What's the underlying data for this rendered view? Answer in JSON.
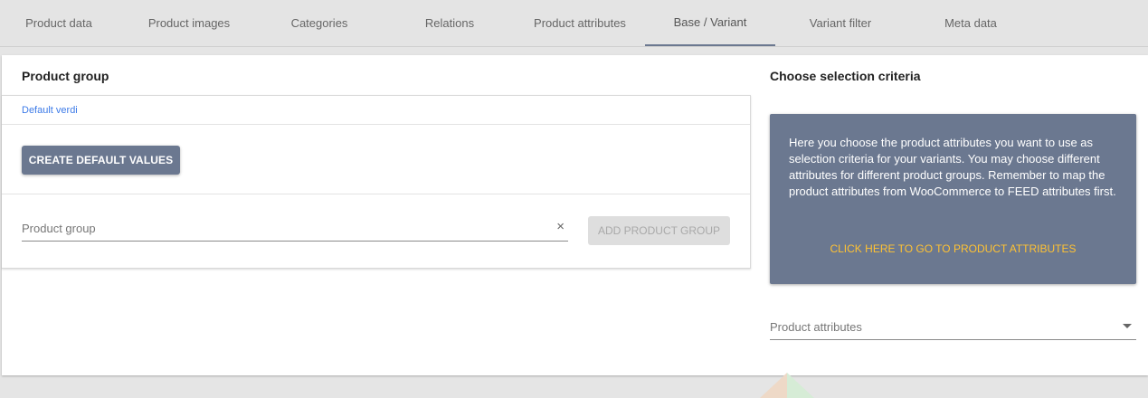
{
  "tabs": [
    {
      "label": "Product data"
    },
    {
      "label": "Product images"
    },
    {
      "label": "Categories"
    },
    {
      "label": "Relations"
    },
    {
      "label": "Product attributes"
    },
    {
      "label": "Base / Variant"
    },
    {
      "label": "Variant filter"
    },
    {
      "label": "Meta data"
    }
  ],
  "active_tab": "Base / Variant",
  "product_group": {
    "title": "Product group",
    "group_name": "Default verdi",
    "create_default_label": "CREATE DEFAULT VALUES",
    "input_placeholder": "Product group",
    "clear_icon": "×",
    "add_label": "ADD PRODUCT GROUP"
  },
  "criteria": {
    "title": "Choose selection criteria",
    "info_text": "Here you choose the product attributes you want to use as selection criteria for your variants. You may choose different attributes for different product groups. Remember to map the product attributes from WooCommerce to FEED attributes first.",
    "link_label": "CLICK HERE TO GO TO PRODUCT ATTRIBUTES",
    "select_label": "Product attributes"
  },
  "colors": {
    "accent": "#6b7890",
    "link": "#ffc233",
    "group_name": "#3d7be8"
  }
}
